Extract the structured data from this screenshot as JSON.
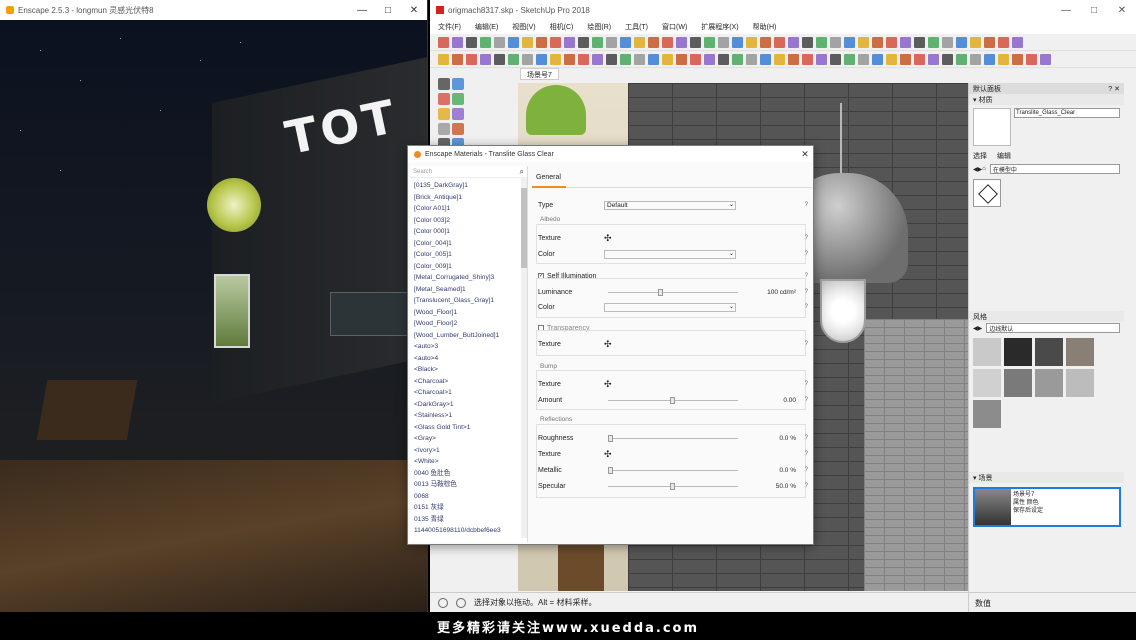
{
  "render_window": {
    "title": "Enscape 2.5.3 - longmun 灵感光伏特8",
    "sign_text": "TOT"
  },
  "sketchup_window": {
    "title": "origmach8317.skp - SketchUp Pro 2018",
    "menu": [
      "文件(F)",
      "编辑(E)",
      "视图(V)",
      "相机(C)",
      "绘图(R)",
      "工具(T)",
      "窗口(W)",
      "扩展程序(X)",
      "帮助(H)"
    ],
    "scene_tab": "场景号7"
  },
  "tray": {
    "title": "默认面板",
    "materials_header": "▾ 材质",
    "material_name": "Translite_Glass_Clear",
    "tabs": [
      "选择",
      "编辑"
    ],
    "library": "在模型中",
    "styles_header": "风格",
    "styles_select": "边线默认",
    "scenes_header": "▾ 场景",
    "scene_item_title": "场景号7",
    "scene_item_sub1": "属性 颜色",
    "scene_item_sub2": "保存后设定"
  },
  "status": {
    "text": "选择对象以拖动。Alt = 材料采样。",
    "measure": "数值"
  },
  "dialog": {
    "title": "Enscape Materials - Translite Glass Clear",
    "search_placeholder": "Search",
    "materials": [
      "[0135_DarkGray]1",
      "[Brick_Antique]1",
      "[Color A01]1",
      "[Color 003]2",
      "[Color 000]1",
      "[Color_004]1",
      "[Color_005]1",
      "[Color_009]1",
      "[Metal_Corrugated_Shiny]3",
      "[Metal_Seamed]1",
      "[Translucent_Glass_Gray]1",
      "[Wood_Floor]1",
      "[Wood_Floor]2",
      "[Wood_Lumber_ButtJoined]1",
      "<auto>3",
      "<auto>4",
      "<Black>",
      "<Charcoal>",
      "<Charcoal>1",
      "<DarkGray>1",
      "<Stainless>1",
      "<Glass Gold Tint>1",
      "<Gray>",
      "<Ivory>1",
      "<White>",
      "0040 鱼肚色",
      "0013 马鞍棕色",
      "0068",
      "0151 灰绿",
      "0135 青绿",
      "11440051698110/dcbbef6ee3"
    ],
    "tab": "General",
    "type_label": "Type",
    "type_value": "Default",
    "albedo_title": "Albedo",
    "texture_label": "Texture",
    "color_label": "Color",
    "self_illum_title": "Self Illumination",
    "luminance_label": "Luminance",
    "luminance_value": "100 cd/m²",
    "transparency_title": "Transparency",
    "bump_title": "Bump",
    "amount_label": "Amount",
    "amount_value": "0.00",
    "reflections_title": "Reflections",
    "roughness_label": "Roughness",
    "roughness_value": "0.0 %",
    "metallic_label": "Metallic",
    "metallic_value": "0.0 %",
    "specular_label": "Specular",
    "specular_value": "50.0 %"
  },
  "watermark": "更多精彩请关注www.xuedda.com"
}
